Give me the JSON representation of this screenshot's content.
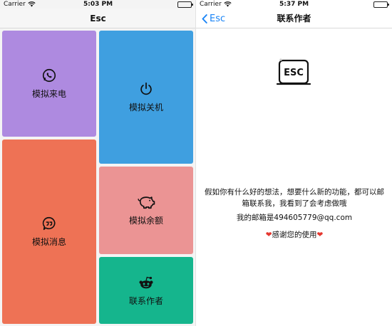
{
  "left": {
    "status": {
      "carrier": "Carrier",
      "time": "5:03 PM"
    },
    "nav": {
      "title": "Esc"
    },
    "tiles": [
      {
        "label": "模拟来电",
        "icon": "phone-icon",
        "color": "#ae8ae0"
      },
      {
        "label": "模拟关机",
        "icon": "power-icon",
        "color": "#3f9fe0"
      },
      {
        "label": "模拟消息",
        "icon": "message-icon",
        "color": "#ee7255"
      },
      {
        "label": "模拟余额",
        "icon": "piggy-bank-icon",
        "color": "#eb9494"
      },
      {
        "label": "联系作者",
        "icon": "reddit-icon",
        "color": "#15b58d"
      }
    ]
  },
  "right": {
    "status": {
      "carrier": "Carrier",
      "time": "5:37 PM"
    },
    "nav": {
      "back": "Esc",
      "title": "联系作者"
    },
    "logo_text": "ESC",
    "message": "假如你有什么好的想法，想要什么新的功能，都可以邮箱联系我，我看到了会考虑做哦",
    "email_line": "我的邮箱是494605779@qq.com",
    "thanks": "感谢您的使用",
    "heart": "❤"
  }
}
